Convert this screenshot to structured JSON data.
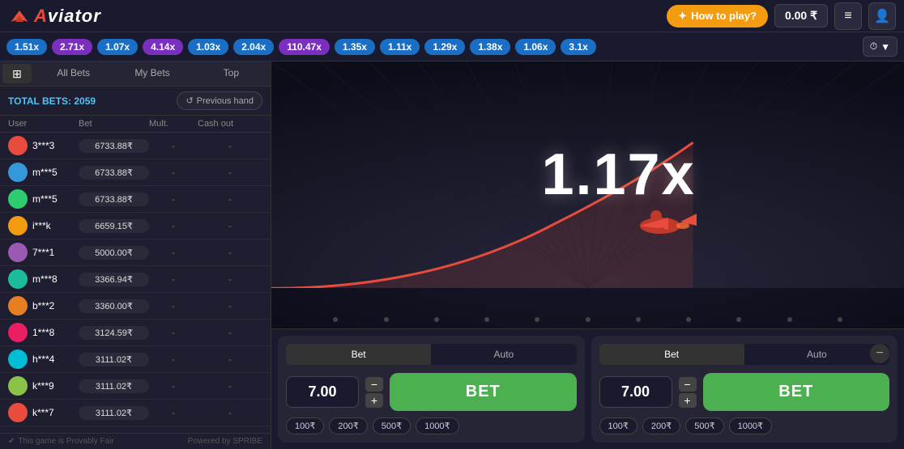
{
  "header": {
    "logo": "Aviator",
    "how_to_play": "How to play?",
    "balance": "0.00 ₹",
    "menu_icon": "≡",
    "profile_icon": "👤"
  },
  "multiplier_bar": {
    "items": [
      {
        "value": "1.51x",
        "color": "blue"
      },
      {
        "value": "2.71x",
        "color": "purple"
      },
      {
        "value": "1.07x",
        "color": "blue"
      },
      {
        "value": "4.14x",
        "color": "purple"
      },
      {
        "value": "1.03x",
        "color": "blue"
      },
      {
        "value": "2.04x",
        "color": "blue"
      },
      {
        "value": "110.47x",
        "color": "purple"
      },
      {
        "value": "1.35x",
        "color": "blue"
      },
      {
        "value": "1.11x",
        "color": "blue"
      },
      {
        "value": "1.29x",
        "color": "blue"
      },
      {
        "value": "1.38x",
        "color": "blue"
      },
      {
        "value": "1.06x",
        "color": "blue"
      },
      {
        "value": "3.1x",
        "color": "blue"
      }
    ]
  },
  "left_panel": {
    "tabs": [
      {
        "label": "All Bets",
        "active": false
      },
      {
        "label": "My Bets",
        "active": false
      },
      {
        "label": "Top",
        "active": false
      }
    ],
    "total_bets_label": "TOTAL BETS:",
    "total_bets_count": "2059",
    "previous_hand_label": "Previous hand",
    "table_headers": [
      "User",
      "Bet",
      "Mult.",
      "Cash out"
    ],
    "bets": [
      {
        "user": "3***3",
        "bet": "6733.88₹",
        "mult": "-",
        "cashout": "-",
        "av": "av-1"
      },
      {
        "user": "m***5",
        "bet": "6733.88₹",
        "mult": "-",
        "cashout": "-",
        "av": "av-2"
      },
      {
        "user": "m***5",
        "bet": "6733.88₹",
        "mult": "-",
        "cashout": "-",
        "av": "av-3"
      },
      {
        "user": "i***k",
        "bet": "6659.15₹",
        "mult": "-",
        "cashout": "-",
        "av": "av-4"
      },
      {
        "user": "7***1",
        "bet": "5000.00₹",
        "mult": "-",
        "cashout": "-",
        "av": "av-5"
      },
      {
        "user": "m***8",
        "bet": "3366.94₹",
        "mult": "-",
        "cashout": "-",
        "av": "av-6"
      },
      {
        "user": "b***2",
        "bet": "3360.00₹",
        "mult": "-",
        "cashout": "-",
        "av": "av-7"
      },
      {
        "user": "1***8",
        "bet": "3124.59₹",
        "mult": "-",
        "cashout": "-",
        "av": "av-8"
      },
      {
        "user": "h***4",
        "bet": "3111.02₹",
        "mult": "-",
        "cashout": "-",
        "av": "av-9"
      },
      {
        "user": "k***9",
        "bet": "3111.02₹",
        "mult": "-",
        "cashout": "-",
        "av": "av-10"
      },
      {
        "user": "k***7",
        "bet": "3111.02₹",
        "mult": "-",
        "cashout": "-",
        "av": "av-1"
      }
    ],
    "footer": "This game is  Provably Fair",
    "powered_by": "Powered by SPRIBE"
  },
  "game": {
    "multiplier": "1.17x"
  },
  "betting_panel_1": {
    "tabs": [
      "Bet",
      "Auto"
    ],
    "active_tab": "Bet",
    "amount": "7.00",
    "bet_label": "BET",
    "quick_amounts": [
      "100₹",
      "200₹",
      "500₹",
      "1000₹"
    ]
  },
  "betting_panel_2": {
    "tabs": [
      "Bet",
      "Auto"
    ],
    "active_tab": "Bet",
    "amount": "7.00",
    "bet_label": "BET",
    "quick_amounts": [
      "100₹",
      "200₹",
      "500₹",
      "1000₹"
    ]
  }
}
